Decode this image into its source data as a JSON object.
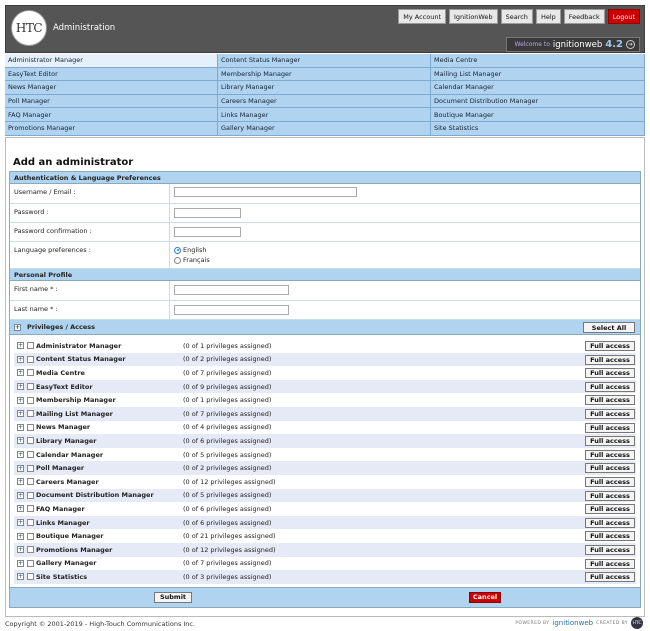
{
  "header": {
    "logo_text": "HTC",
    "app_title": "Administration",
    "nav": [
      "My Account",
      "IgnitionWeb",
      "Search",
      "Help",
      "Feedback"
    ],
    "logout_label": "Logout",
    "welcome_prefix": "Welcome to",
    "welcome_brand": "ignitionweb",
    "welcome_version": "4.2"
  },
  "modules": [
    "Administrator Manager",
    "Content Status Manager",
    "Media Centre",
    "EasyText Editor",
    "Membership Manager",
    "Mailing List Manager",
    "News Manager",
    "Library Manager",
    "Calendar Manager",
    "Poll Manager",
    "Careers Manager",
    "Document Distribution Manager",
    "FAQ Manager",
    "Links Manager",
    "Boutique Manager",
    "Promotions Manager",
    "Gallery Manager",
    "Site Statistics"
  ],
  "page_title": "Add an administrator",
  "auth": {
    "section_title": "Authentication & Language Preferences",
    "username_label": "Username / Email :",
    "password_label": "Password :",
    "password_confirm_label": "Password confirmation :",
    "language_label": "Language preferences :",
    "lang_english": "English",
    "lang_french": "Français",
    "selected_language": "English"
  },
  "profile": {
    "section_title": "Personal Profile",
    "first_name_label": "First name * :",
    "last_name_label": "Last name * :"
  },
  "privileges": {
    "section_title": "Privileges / Access",
    "select_all_label": "Select All",
    "full_access_label": "Full access",
    "rows": [
      {
        "name": "Administrator Manager",
        "count": "(0 of 1 privileges assigned)"
      },
      {
        "name": "Content Status Manager",
        "count": "(0 of 2 privileges assigned)"
      },
      {
        "name": "Media Centre",
        "count": "(0 of 7 privileges assigned)"
      },
      {
        "name": "EasyText Editor",
        "count": "(0 of 9 privileges assigned)"
      },
      {
        "name": "Membership Manager",
        "count": "(0 of 1 privileges assigned)"
      },
      {
        "name": "Mailing List Manager",
        "count": "(0 of 7 privileges assigned)"
      },
      {
        "name": "News Manager",
        "count": "(0 of 4 privileges assigned)"
      },
      {
        "name": "Library Manager",
        "count": "(0 of 6 privileges assigned)"
      },
      {
        "name": "Calendar Manager",
        "count": "(0 of 5 privileges assigned)"
      },
      {
        "name": "Poll Manager",
        "count": "(0 of 2 privileges assigned)"
      },
      {
        "name": "Careers Manager",
        "count": "(0 of 12 privileges assigned)"
      },
      {
        "name": "Document Distribution Manager",
        "count": "(0 of 5 privileges assigned)"
      },
      {
        "name": "FAQ Manager",
        "count": "(0 of 6 privileges assigned)"
      },
      {
        "name": "Links Manager",
        "count": "(0 of 6 privileges assigned)"
      },
      {
        "name": "Boutique Manager",
        "count": "(0 of 21 privileges assigned)"
      },
      {
        "name": "Promotions Manager",
        "count": "(0 of 12 privileges assigned)"
      },
      {
        "name": "Gallery Manager",
        "count": "(0 of 7 privileges assigned)"
      },
      {
        "name": "Site Statistics",
        "count": "(0 of 3 privileges assigned)"
      }
    ]
  },
  "actions": {
    "submit_label": "Submit",
    "cancel_label": "Cancel"
  },
  "footer": {
    "copyright": "Copyright © 2001-2019 - High-Touch Communications Inc.",
    "powered_by": "POWERED BY",
    "powered_brand": "ignitionweb",
    "created_by": "CREATED BY",
    "created_brand": "HTC"
  },
  "colors": {
    "header_bg": "#555555",
    "section_blue": "#b0d3f0",
    "logout_red": "#cc0000",
    "row_stripe": "#e6e9f6"
  }
}
